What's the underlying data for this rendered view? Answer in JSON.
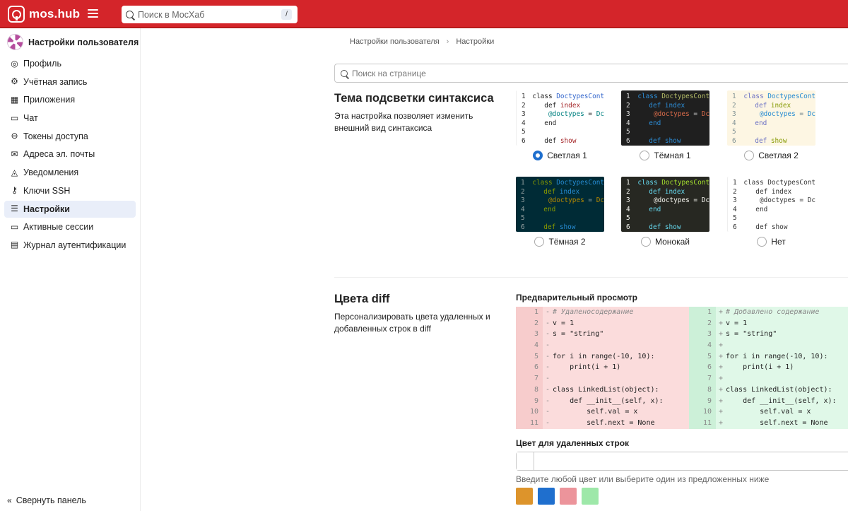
{
  "header": {
    "logo_text": "mos.hub",
    "search_placeholder": "Поиск в МосХаб",
    "search_shortcut": "/"
  },
  "sidebar": {
    "title": "Настройки пользователя",
    "items": [
      {
        "label": "Профиль",
        "icon": "user-circle-icon",
        "glyph": "◎",
        "active": false
      },
      {
        "label": "Учётная запись",
        "icon": "account-settings-icon",
        "glyph": "⚙",
        "active": false
      },
      {
        "label": "Приложения",
        "icon": "apps-grid-icon",
        "glyph": "▦",
        "active": false
      },
      {
        "label": "Чат",
        "icon": "chat-bubble-icon",
        "glyph": "▭",
        "active": false
      },
      {
        "label": "Токены доступа",
        "icon": "token-icon",
        "glyph": "⊖",
        "active": false
      },
      {
        "label": "Адреса эл. почты",
        "icon": "envelope-icon",
        "glyph": "✉",
        "active": false
      },
      {
        "label": "Уведомления",
        "icon": "bell-icon",
        "glyph": "◬",
        "active": false
      },
      {
        "label": "Ключи SSH",
        "icon": "key-icon",
        "glyph": "⚷",
        "active": false
      },
      {
        "label": "Настройки",
        "icon": "preferences-sliders-icon",
        "glyph": "☰",
        "active": true
      },
      {
        "label": "Активные сессии",
        "icon": "monitor-icon",
        "glyph": "▭",
        "active": false
      },
      {
        "label": "Журнал аутентификации",
        "icon": "log-list-icon",
        "glyph": "▤",
        "active": false
      }
    ],
    "collapse_label": "Свернуть панель"
  },
  "breadcrumb": [
    "Настройки пользователя",
    "Настройки"
  ],
  "page_search_placeholder": "Поиск на странице",
  "syntax": {
    "title": "Тема подсветки синтаксиса",
    "description": "Эта настройка позволяет изменить внешний вид синтаксиса",
    "code_lines": [
      "class DoctypesCont",
      "  def index",
      "    @doctypes = Dc",
      "  end",
      "",
      "  def show"
    ],
    "themes": [
      {
        "label": "Светлая 1",
        "selected": true,
        "bg": "#ffffff",
        "num": "#333333",
        "kw": "#222222",
        "name": "#3366cc",
        "var": "#008080",
        "def": "#a5272a",
        "text": "#222222"
      },
      {
        "label": "Тёмная 1",
        "selected": false,
        "bg": "#1f1f1f",
        "num": "#dddddd",
        "kw": "#2d8ed8",
        "name": "#b5bd68",
        "var": "#d86b4a",
        "def": "#2d8ed8",
        "text": "#cccccc"
      },
      {
        "label": "Светлая 2",
        "selected": false,
        "bg": "#fdf6e3",
        "num": "#839496",
        "kw": "#6c71c4",
        "name": "#268bd2",
        "var": "#268bd2",
        "def": "#859900",
        "text": "#657b83"
      },
      {
        "label": "Тёмная 2",
        "selected": false,
        "bg": "#002b36",
        "num": "#93a1a1",
        "kw": "#859900",
        "name": "#268bd2",
        "var": "#b58900",
        "def": "#268bd2",
        "text": "#93a1a1"
      },
      {
        "label": "Монокай",
        "selected": false,
        "bg": "#272822",
        "num": "#f8f8f2",
        "kw": "#66d9ef",
        "name": "#a6e22e",
        "var": "#f8f8f2",
        "def": "#66d9ef",
        "text": "#f8f8f2"
      },
      {
        "label": "Нет",
        "selected": false,
        "bg": "#ffffff",
        "num": "#333333",
        "kw": "#333333",
        "name": "#333333",
        "var": "#333333",
        "def": "#333333",
        "text": "#333333"
      }
    ]
  },
  "diff": {
    "title": "Цвета diff",
    "description": "Персонализировать цвета удаленных и добавленных строк в diff",
    "preview_label": "Предварительный просмотр",
    "removed_bg": "#fbdcdc",
    "added_bg": "#e0f8e8",
    "removed_lines": [
      {
        "num": "1",
        "sign": "-",
        "code": "# Удаленосодержание"
      },
      {
        "num": "2",
        "sign": "-",
        "code": "v = 1"
      },
      {
        "num": "3",
        "sign": "-",
        "code": "s = \"string\""
      },
      {
        "num": "4",
        "sign": "-",
        "code": ""
      },
      {
        "num": "5",
        "sign": "-",
        "code": "for i in range(-10, 10):"
      },
      {
        "num": "6",
        "sign": "-",
        "code": "    print(i + 1)"
      },
      {
        "num": "7",
        "sign": "-",
        "code": ""
      },
      {
        "num": "8",
        "sign": "-",
        "code": "class LinkedList(object):"
      },
      {
        "num": "9",
        "sign": "-",
        "code": "    def __init__(self, x):"
      },
      {
        "num": "10",
        "sign": "-",
        "code": "        self.val = x"
      },
      {
        "num": "11",
        "sign": "-",
        "code": "        self.next = None"
      }
    ],
    "added_lines": [
      {
        "num": "1",
        "sign": "+",
        "code": "# Добавлено содержание"
      },
      {
        "num": "2",
        "sign": "+",
        "code": "v = 1"
      },
      {
        "num": "3",
        "sign": "+",
        "code": "s = \"string\""
      },
      {
        "num": "4",
        "sign": "+",
        "code": ""
      },
      {
        "num": "5",
        "sign": "+",
        "code": "for i in range(-10, 10):"
      },
      {
        "num": "6",
        "sign": "+",
        "code": "    print(i + 1)"
      },
      {
        "num": "7",
        "sign": "+",
        "code": ""
      },
      {
        "num": "8",
        "sign": "+",
        "code": "class LinkedList(object):"
      },
      {
        "num": "9",
        "sign": "+",
        "code": "    def __init__(self, x):"
      },
      {
        "num": "10",
        "sign": "+",
        "code": "        self.val = x"
      },
      {
        "num": "11",
        "sign": "+",
        "code": "        self.next = None"
      }
    ],
    "removed_color_label": "Цвет для удаленных строк",
    "removed_color_value": "",
    "color_help": "Введите любой цвет или выберите один из предложенных ниже",
    "swatches": [
      "#dd942b",
      "#1f6fce",
      "#ec949b",
      "#9ee8a9"
    ]
  }
}
